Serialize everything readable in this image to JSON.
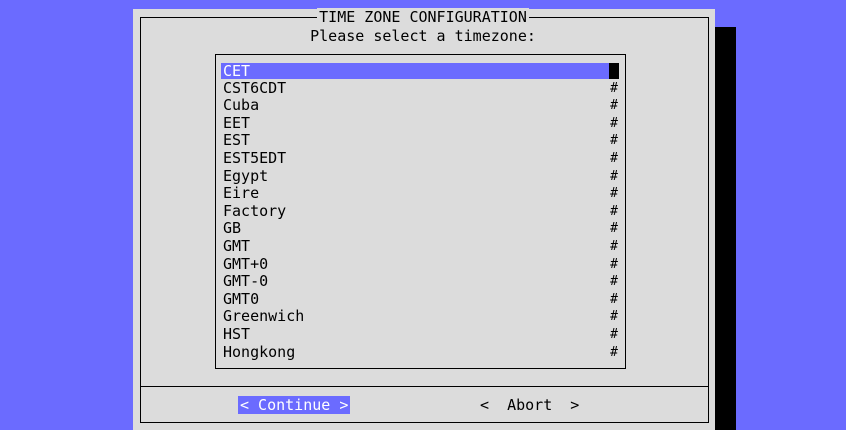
{
  "dialog": {
    "title": "TIME ZONE CONFIGURATION",
    "subtitle": "Please select a timezone:"
  },
  "list": {
    "items": [
      {
        "label": "CET",
        "selected": true
      },
      {
        "label": "CST6CDT"
      },
      {
        "label": "Cuba"
      },
      {
        "label": "EET"
      },
      {
        "label": "EST"
      },
      {
        "label": "EST5EDT"
      },
      {
        "label": "Egypt"
      },
      {
        "label": "Eire"
      },
      {
        "label": "Factory"
      },
      {
        "label": "GB"
      },
      {
        "label": "GMT"
      },
      {
        "label": "GMT+0"
      },
      {
        "label": "GMT-0"
      },
      {
        "label": "GMT0"
      },
      {
        "label": "Greenwich"
      },
      {
        "label": "HST"
      },
      {
        "label": "Hongkong"
      }
    ],
    "scroll_track_char": "#"
  },
  "buttons": {
    "continue_label": "< Continue >",
    "abort_label": "<  Abort  >"
  },
  "colors": {
    "background": "#6b6bff",
    "dialog": "#dcdcdc",
    "highlight": "#6b6bff",
    "shadow": "#000000"
  }
}
